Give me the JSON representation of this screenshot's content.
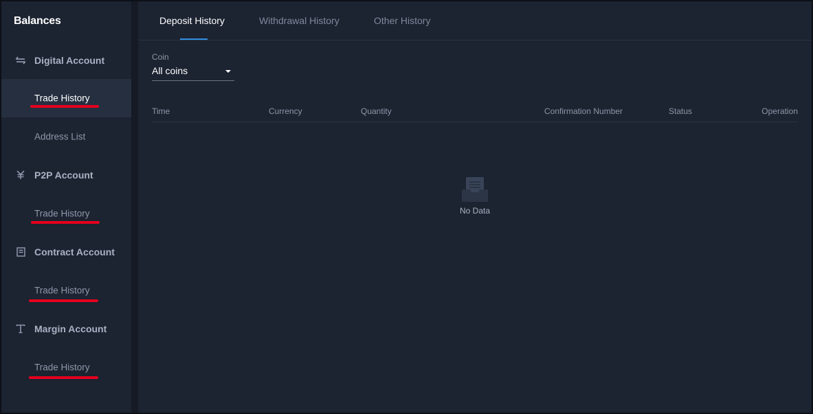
{
  "sidebar": {
    "title": "Balances",
    "sections": [
      {
        "label": "Digital Account",
        "icon": "transfer-arrows-icon",
        "items": [
          {
            "label": "Trade History",
            "active": true
          },
          {
            "label": "Address List",
            "active": false
          }
        ]
      },
      {
        "label": "P2P Account",
        "icon": "yen-icon",
        "items": [
          {
            "label": "Trade History",
            "active": false
          }
        ]
      },
      {
        "label": "Contract Account",
        "icon": "receipt-icon",
        "items": [
          {
            "label": "Trade History",
            "active": false
          }
        ]
      },
      {
        "label": "Margin Account",
        "icon": "text-t-icon",
        "items": [
          {
            "label": "Trade History",
            "active": false
          }
        ]
      }
    ]
  },
  "main": {
    "tabs": [
      {
        "label": "Deposit History",
        "active": true
      },
      {
        "label": "Withdrawal History",
        "active": false
      },
      {
        "label": "Other History",
        "active": false
      }
    ],
    "filter": {
      "coin_label": "Coin",
      "coin_value": "All coins"
    },
    "table": {
      "columns": [
        "Time",
        "Currency",
        "Quantity",
        "Confirmation Number",
        "Status",
        "Operation"
      ],
      "rows": [],
      "empty_text": "No Data"
    }
  },
  "colors": {
    "background": "#1c2331",
    "active_tab_indicator": "#2f8fe0",
    "annotation_underline": "#e6001e"
  }
}
